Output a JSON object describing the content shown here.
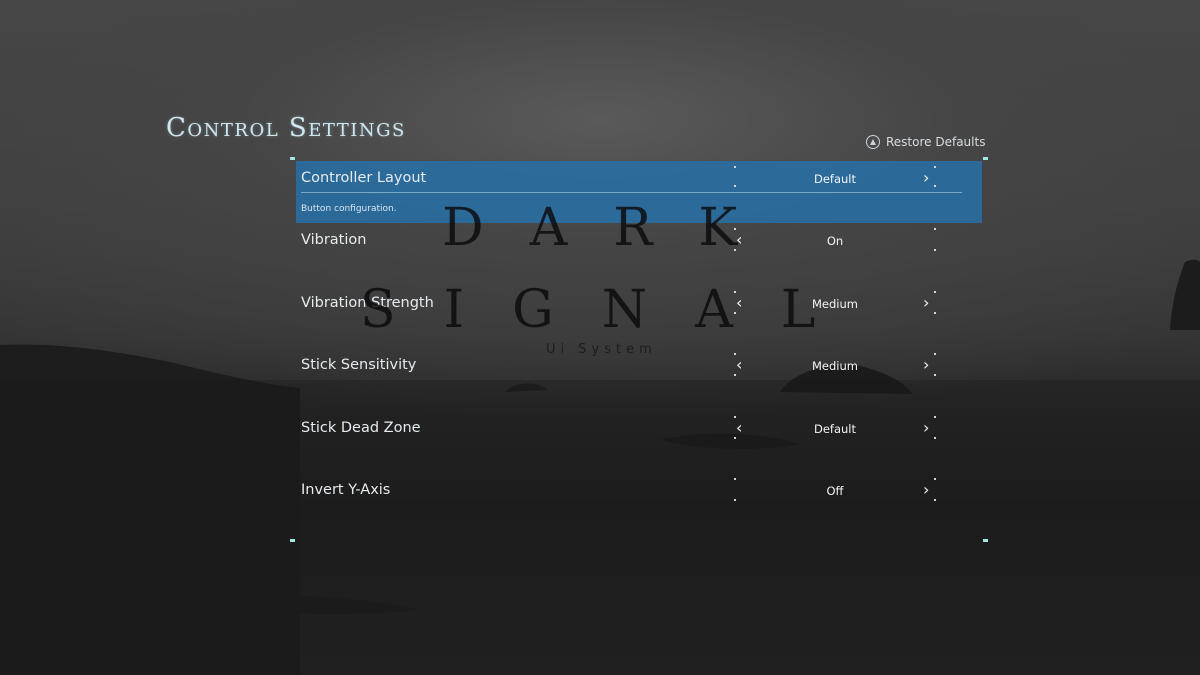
{
  "screen": {
    "title": "Control Settings",
    "restore_defaults": {
      "label": "Restore Defaults",
      "icon": "triangle-button-icon"
    },
    "accent_color": "#286ea5",
    "settings": [
      {
        "label": "Controller Layout",
        "value": "Default",
        "description": "Button configuration.",
        "selected": true
      },
      {
        "label": "Vibration",
        "value": "On"
      },
      {
        "label": "Vibration Strength",
        "value": "Medium"
      },
      {
        "label": "Stick Sensitivity",
        "value": "Medium"
      },
      {
        "label": "Stick Dead Zone",
        "value": "Default"
      },
      {
        "label": "Invert Y-Axis",
        "value": "Off"
      }
    ],
    "arrows": {
      "left": "‹",
      "right": "›"
    }
  },
  "logo": {
    "line1": "DARK",
    "line2": "SIGNAL",
    "subtitle": "Ui System"
  }
}
